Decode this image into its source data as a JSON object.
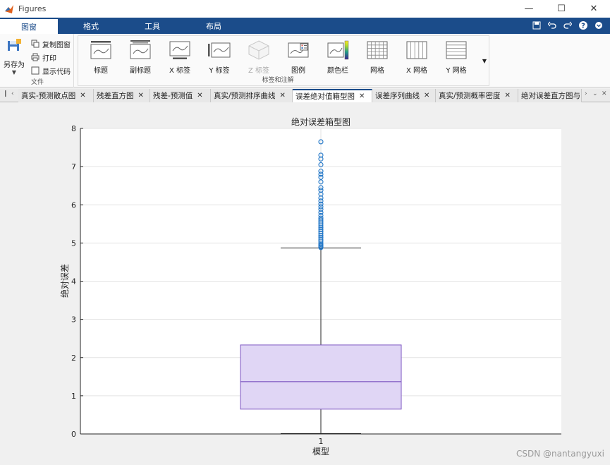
{
  "window": {
    "title": "Figures",
    "min": "—",
    "max": "☐",
    "close": "✕"
  },
  "toolstrip": {
    "tabs": [
      "图窗",
      "格式",
      "工具",
      "布局"
    ],
    "active": 0
  },
  "file_group": {
    "save_as": "另存为",
    "copy_figure": "复制图窗",
    "print": "打印",
    "show_code": "显示代码",
    "label": "文件"
  },
  "labels_group": {
    "label": "标签和注解",
    "tools": [
      {
        "name": "title",
        "label": "标题"
      },
      {
        "name": "subtitle",
        "label": "副标题"
      },
      {
        "name": "xlabel",
        "label": "X 标签"
      },
      {
        "name": "ylabel",
        "label": "Y 标签"
      },
      {
        "name": "zlabel",
        "label": "Z 标签"
      },
      {
        "name": "legend",
        "label": "图例"
      },
      {
        "name": "colorbar",
        "label": "颜色栏"
      },
      {
        "name": "grid",
        "label": "网格"
      },
      {
        "name": "xgrid",
        "label": "X 网格"
      },
      {
        "name": "ygrid",
        "label": "Y 网格"
      }
    ]
  },
  "doc_tabs": [
    {
      "label": "真实-预测散点图"
    },
    {
      "label": "残差直方图"
    },
    {
      "label": "残差-预测值"
    },
    {
      "label": "真实/预测排序曲线"
    },
    {
      "label": "误差绝对值箱型图"
    },
    {
      "label": "误差序列曲线"
    },
    {
      "label": "真实/预测概率密度"
    },
    {
      "label": "绝对误差直方图与"
    }
  ],
  "active_doc_tab": 4,
  "colors": {
    "accent": "#1b4c8a",
    "box_fill": "#e0d6f5",
    "box_edge": "#7e57c2",
    "outlier": "#2176c7"
  },
  "chart_data": {
    "type": "box",
    "title": "绝对误差箱型图",
    "xlabel": "模型",
    "ylabel": "绝对误差",
    "categories": [
      "1"
    ],
    "ylim": [
      0,
      8
    ],
    "yticks": [
      0,
      1,
      2,
      3,
      4,
      5,
      6,
      7,
      8
    ],
    "grid": true,
    "box": {
      "min": 0.0,
      "q1": 0.65,
      "median": 1.37,
      "q3": 2.33,
      "whisker_high": 4.87
    },
    "outliers": [
      4.88,
      4.9,
      4.93,
      4.96,
      5.0,
      5.05,
      5.1,
      5.15,
      5.2,
      5.25,
      5.3,
      5.35,
      5.4,
      5.45,
      5.5,
      5.55,
      5.6,
      5.65,
      5.72,
      5.8,
      5.88,
      5.95,
      6.02,
      6.1,
      6.18,
      6.28,
      6.38,
      6.45,
      6.6,
      6.72,
      6.8,
      6.88,
      7.05,
      7.2,
      7.3,
      7.65
    ]
  },
  "watermark": "CSDN @nantangyuxi"
}
